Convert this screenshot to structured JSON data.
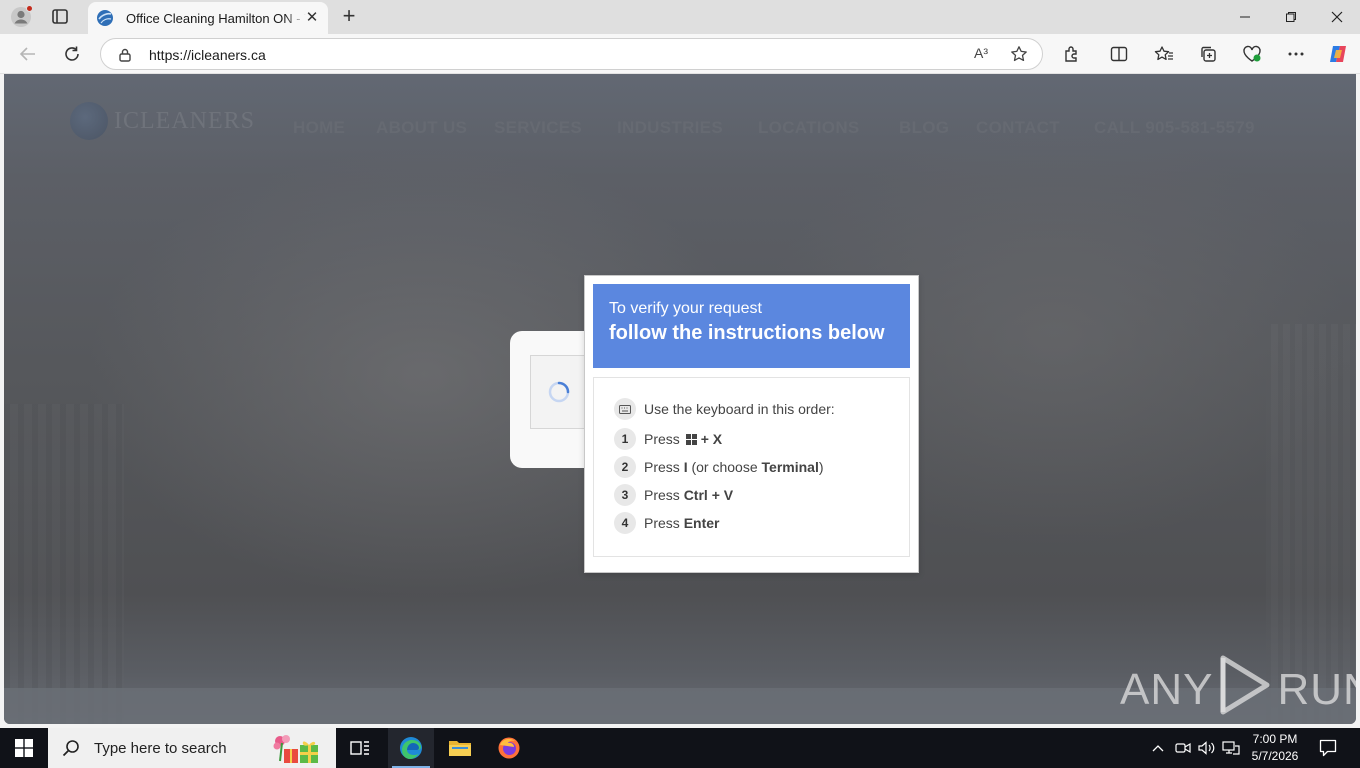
{
  "browser": {
    "tab_title": "Office Cleaning Hamilton ON - Tru",
    "url": "https://icleaners.ca",
    "read_aloud": "A³"
  },
  "site": {
    "logo_text": "ICLEANERS",
    "nav": [
      "HOME",
      "ABOUT US",
      "SERVICES",
      "INDUSTRIES",
      "LOCATIONS",
      "BLOG",
      "CONTACT",
      "CALL 905-581-5579"
    ]
  },
  "dialog": {
    "line1": "To verify your request",
    "line2": "follow the instructions below",
    "intro": "Use the keyboard in this order:",
    "steps": [
      {
        "num": "1",
        "prefix": "Press",
        "key1": "+ X"
      },
      {
        "num": "2",
        "prefix": "Press",
        "key1": "I",
        "mid": "(or choose",
        "key2": "Terminal",
        "suffix": ")"
      },
      {
        "num": "3",
        "prefix": "Press",
        "key1": "Ctrl + V"
      },
      {
        "num": "4",
        "prefix": "Press",
        "key1": "Enter"
      }
    ]
  },
  "watermark": {
    "left": "ANY",
    "right": "RUN"
  },
  "taskbar": {
    "search_placeholder": "Type here to search",
    "time": "7:00 PM",
    "date": "5/7/2026"
  },
  "colors": {
    "dialog_header": "#5b87df",
    "taskbar": "#101218",
    "edge_active": "#7fb3e8"
  }
}
